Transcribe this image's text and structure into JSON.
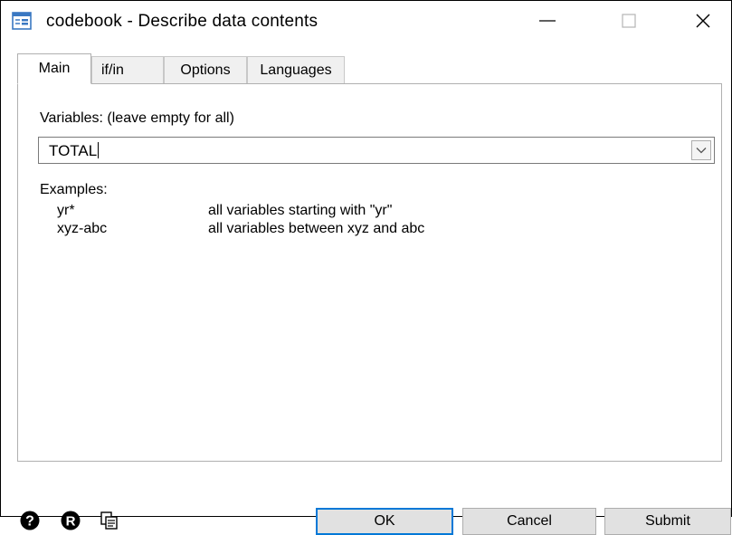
{
  "window": {
    "title": "codebook - Describe data contents",
    "icon": "dialog-app-icon",
    "controls": [
      "minimize-icon",
      "maximize-icon",
      "close-icon"
    ]
  },
  "tabs": [
    {
      "label": "Main",
      "active": true
    },
    {
      "label": "if/in",
      "active": false
    },
    {
      "label": "Options",
      "active": false
    },
    {
      "label": "Languages",
      "active": false
    }
  ],
  "main": {
    "variables_label": "Variables: (leave empty for all)",
    "variables_value": "TOTAL",
    "examples_label": "Examples:",
    "examples": [
      {
        "term": "yr*",
        "description": "all variables starting with \"yr\""
      },
      {
        "term": "xyz-abc",
        "description": "all variables between xyz and abc"
      }
    ]
  },
  "footer": {
    "icons": [
      "help-icon",
      "reset-icon",
      "copy-command-icon"
    ],
    "ok_label": "OK",
    "cancel_label": "Cancel",
    "submit_label": "Submit"
  }
}
